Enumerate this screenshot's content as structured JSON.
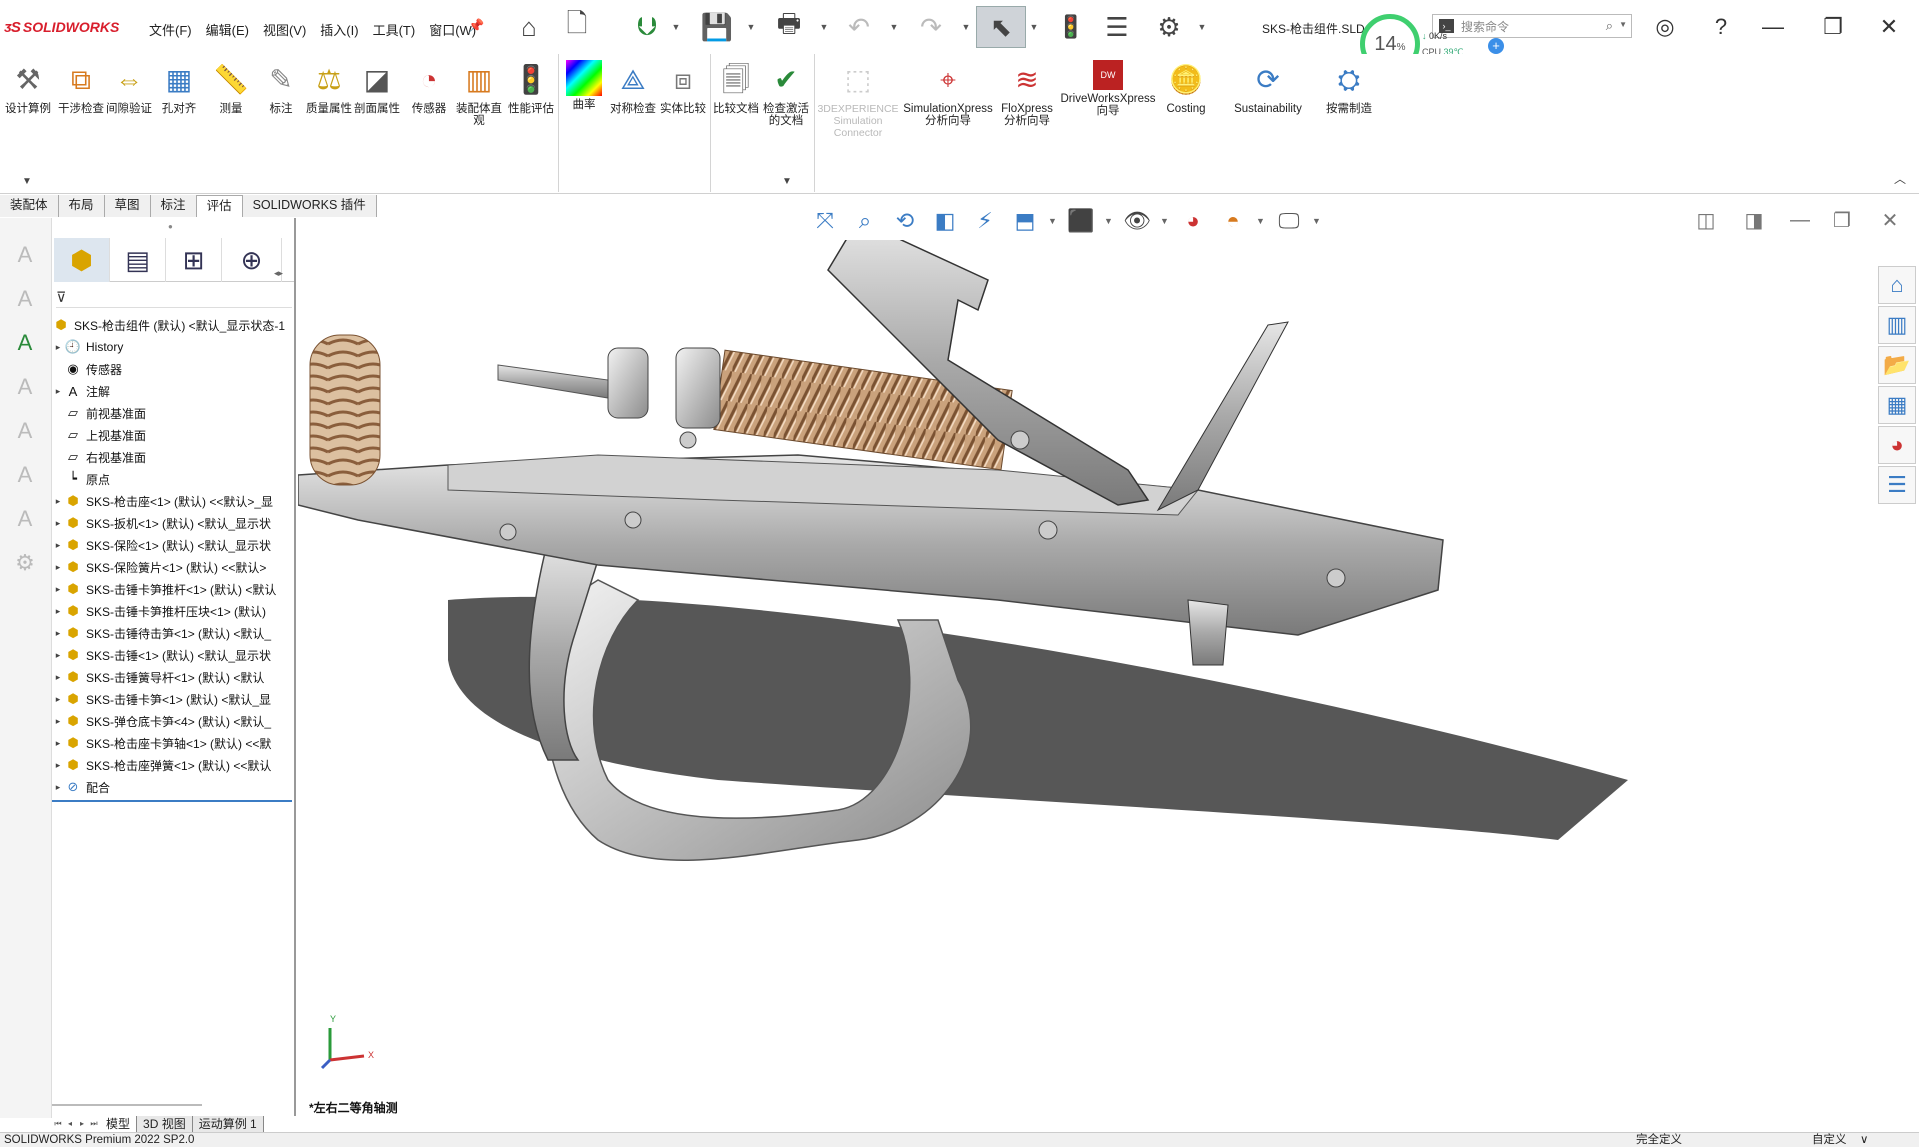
{
  "app": {
    "logo_text": "SOLIDWORKS",
    "document_title": "SKS-枪击组件.SLDASM",
    "menu": [
      "文件(F)",
      "编辑(E)",
      "视图(V)",
      "插入(I)",
      "工具(T)",
      "窗口(W)"
    ]
  },
  "toolbar": {
    "icons": [
      "home-icon",
      "new-document-icon",
      "open-icon",
      "save-icon",
      "print-icon",
      "undo-icon",
      "redo-icon",
      "select-icon",
      "rebuild-icon",
      "file-properties-icon",
      "options-icon"
    ]
  },
  "system_widget": {
    "cpu_percent": "14",
    "cpu_percent_unit": "%",
    "net_speed": "0K/s",
    "cpu_label": "CPU",
    "cpu_temp": "39℃"
  },
  "search": {
    "placeholder": "搜索命令"
  },
  "ribbon": {
    "items": [
      {
        "label": "设计算例",
        "icon": "design-study-icon"
      },
      {
        "label": "干涉检查",
        "icon": "interference-check-icon"
      },
      {
        "label": "间隙验证",
        "icon": "clearance-verification-icon"
      },
      {
        "label": "孔对齐",
        "icon": "hole-alignment-icon"
      },
      {
        "label": "测量",
        "icon": "measure-icon"
      },
      {
        "label": "标注",
        "icon": "markup-icon"
      },
      {
        "label": "质量属性",
        "icon": "mass-properties-icon"
      },
      {
        "label": "剖面属性",
        "icon": "section-properties-icon"
      },
      {
        "label": "传感器",
        "icon": "sensor-icon"
      },
      {
        "label": "装配体直观",
        "icon": "assembly-visualization-icon"
      },
      {
        "label": "性能评估",
        "icon": "performance-evaluation-icon"
      },
      {
        "label": "曲率",
        "icon": "curvature-icon"
      },
      {
        "label": "对称检查",
        "icon": "symmetry-check-icon"
      },
      {
        "label": "实体比较",
        "icon": "compare-bodies-icon"
      },
      {
        "label": "比较文档",
        "icon": "compare-documents-icon"
      },
      {
        "label": "检查激活的文档",
        "icon": "check-active-document-icon"
      },
      {
        "label": "3DEXPERIENCE Simulation Connector",
        "icon": "3dexperience-icon"
      },
      {
        "label": "SimulationXpress 分析向导",
        "icon": "simulationxpress-icon"
      },
      {
        "label": "FloXpress 分析向导",
        "icon": "floxpress-icon"
      },
      {
        "label": "DriveWorksXpress 向导",
        "icon": "driveworksxpress-icon"
      },
      {
        "label": "Costing",
        "icon": "costing-icon"
      },
      {
        "label": "Sustainability",
        "icon": "sustainability-icon"
      },
      {
        "label": "按需制造",
        "icon": "manufacturing-on-demand-icon"
      }
    ]
  },
  "command_tabs": [
    "装配体",
    "布局",
    "草图",
    "标注",
    "评估",
    "SOLIDWORKS 插件"
  ],
  "active_command_tab": "评估",
  "feature_tree": {
    "root": "SKS-枪击组件 (默认) <默认_显示状态-1",
    "items": [
      {
        "label": "History",
        "icon": "history-icon",
        "expand": true
      },
      {
        "label": "传感器",
        "icon": "sensor-folder-icon",
        "expand": false
      },
      {
        "label": "注解",
        "icon": "annotations-icon",
        "expand": true
      },
      {
        "label": "前视基准面",
        "icon": "plane-icon",
        "expand": false
      },
      {
        "label": "上视基准面",
        "icon": "plane-icon",
        "expand": false
      },
      {
        "label": "右视基准面",
        "icon": "plane-icon",
        "expand": false
      },
      {
        "label": "原点",
        "icon": "origin-icon",
        "expand": false
      },
      {
        "label": "SKS-枪击座<1> (默认) <<默认>_显",
        "icon": "part-icon",
        "expand": true
      },
      {
        "label": "SKS-扳机<1> (默认) <默认_显示状",
        "icon": "part-icon",
        "expand": true
      },
      {
        "label": "SKS-保险<1> (默认) <默认_显示状",
        "icon": "part-icon",
        "expand": true
      },
      {
        "label": "SKS-保险簧片<1> (默认) <<默认>",
        "icon": "part-icon",
        "expand": true
      },
      {
        "label": "SKS-击锤卡笋推杆<1> (默认) <默认",
        "icon": "part-icon",
        "expand": true
      },
      {
        "label": "SKS-击锤卡笋推杆压块<1> (默认)",
        "icon": "part-icon",
        "expand": true
      },
      {
        "label": "SKS-击锤待击笋<1> (默认) <默认_",
        "icon": "part-icon",
        "expand": true
      },
      {
        "label": "SKS-击锤<1> (默认) <默认_显示状",
        "icon": "part-icon",
        "expand": true
      },
      {
        "label": "SKS-击锤簧导杆<1> (默认) <默认",
        "icon": "part-icon",
        "expand": true
      },
      {
        "label": "SKS-击锤卡笋<1> (默认) <默认_显",
        "icon": "part-icon",
        "expand": true
      },
      {
        "label": "SKS-弹仓底卡笋<4> (默认) <默认_",
        "icon": "part-icon",
        "expand": true
      },
      {
        "label": "SKS-枪击座卡笋轴<1> (默认) <<默",
        "icon": "part-icon",
        "expand": true
      },
      {
        "label": "SKS-枪击座弹簧<1> (默认) <<默认",
        "icon": "part-icon",
        "expand": true
      },
      {
        "label": "配合",
        "icon": "mates-icon",
        "expand": true
      }
    ]
  },
  "bottom_tabs": [
    "模型",
    "3D 视图",
    "运动算例 1"
  ],
  "view_label": "*左右二等角轴测",
  "triad": {
    "x": "X",
    "y": "Y"
  },
  "status": {
    "left": "SOLIDWORKS Premium 2022 SP2.0",
    "middle": "完全定义",
    "right": "自定义"
  }
}
